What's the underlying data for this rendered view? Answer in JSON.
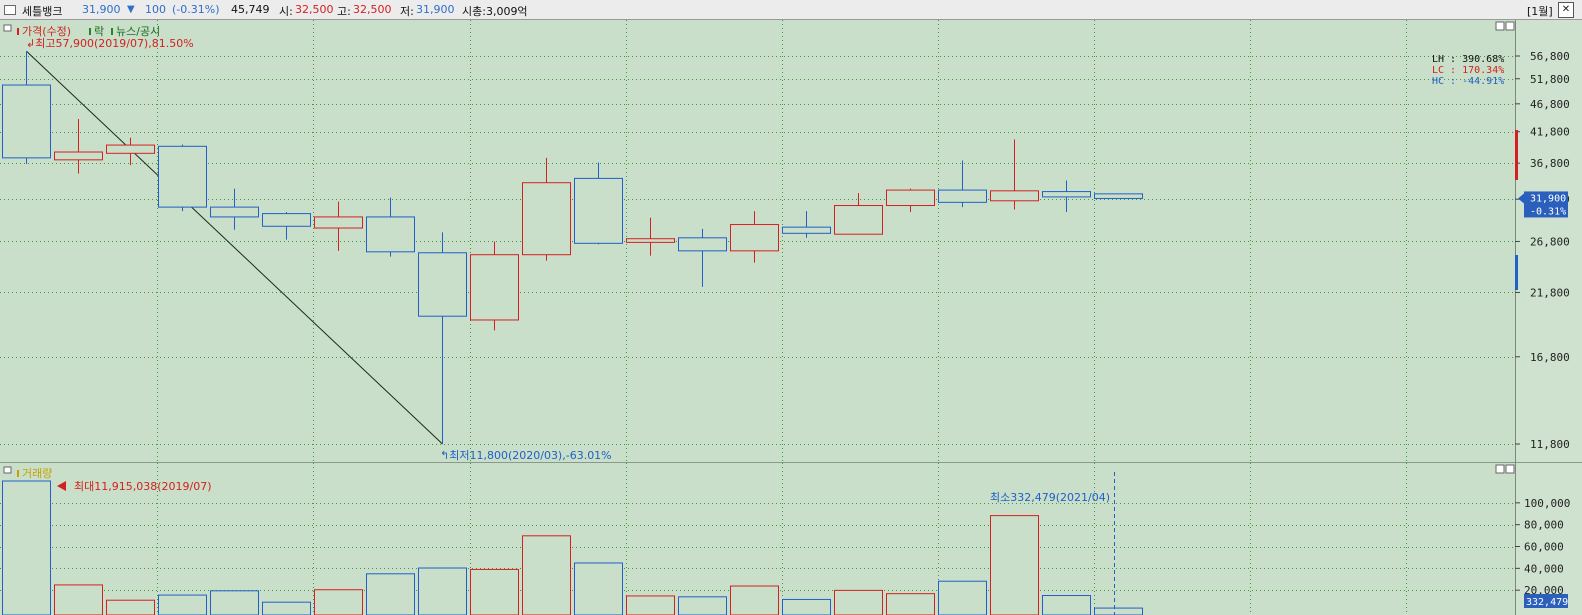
{
  "header": {
    "name": "세틀뱅크",
    "price": "31,900",
    "change_arrow": "▼",
    "change": "100",
    "change_pct": "(-0.31%)",
    "volume": "45,749",
    "open_label": "시:",
    "open": "32,500",
    "high_label": "고:",
    "high": "32,500",
    "low_label": "저:",
    "low": "31,900",
    "mcap": "시총:3,009억",
    "period": "[1월]",
    "close_glyph": "✕"
  },
  "price_panel": {
    "legend_price": "가격(수정)",
    "legend_ex": "락",
    "legend_news": "뉴스/공시",
    "max_annotation": "최고57,900(2019/07),81.50%",
    "min_annotation": "최저11,800(2020/03),-63.01%",
    "lh": "LH : 390.68%",
    "lc": "LC : 170.34%",
    "hc": "HC : -44.91%",
    "current_price_tag": "31,900",
    "current_change_tag": "-0.31%"
  },
  "volume_panel": {
    "legend": "거래량",
    "max_annotation": "최대11,915,038(2019/07)",
    "min_annotation": "최소332,479(2021/04)",
    "current_volume_tag": "332,479"
  },
  "colors": {
    "up": "#d42020",
    "down": "#2060c8",
    "background": "#c9dfc9",
    "grid": "#3a9a3a"
  },
  "chart_data": [
    {
      "type": "candlestick",
      "title": "가격(수정)",
      "interval": "monthly",
      "y_scale": "log",
      "ylim": [
        10800,
        62000
      ],
      "y_ticks": [
        56800,
        51800,
        46800,
        41800,
        36800,
        31800,
        26800,
        21800,
        16800,
        11800
      ],
      "candles": [
        {
          "open": 50500,
          "high": 57900,
          "low": 36700,
          "close": 37600,
          "dir": "down"
        },
        {
          "open": 37300,
          "high": 44000,
          "low": 35300,
          "close": 38500,
          "dir": "up"
        },
        {
          "open": 38300,
          "high": 40800,
          "low": 36500,
          "close": 39600,
          "dir": "up"
        },
        {
          "open": 39400,
          "high": 39700,
          "low": 30300,
          "close": 30800,
          "dir": "down"
        },
        {
          "open": 30800,
          "high": 33200,
          "low": 28100,
          "close": 29600,
          "dir": "down"
        },
        {
          "open": 30000,
          "high": 30200,
          "low": 27000,
          "close": 28500,
          "dir": "down"
        },
        {
          "open": 28300,
          "high": 31500,
          "low": 25800,
          "close": 29600,
          "dir": "up"
        },
        {
          "open": 29600,
          "high": 32000,
          "low": 25200,
          "close": 25700,
          "dir": "down"
        },
        {
          "open": 25600,
          "high": 27800,
          "low": 11800,
          "close": 19800,
          "dir": "down"
        },
        {
          "open": 19500,
          "high": 26800,
          "low": 18700,
          "close": 25400,
          "dir": "up"
        },
        {
          "open": 25400,
          "high": 37600,
          "low": 24800,
          "close": 34000,
          "dir": "up"
        },
        {
          "open": 34600,
          "high": 36900,
          "low": 26500,
          "close": 26600,
          "dir": "down"
        },
        {
          "open": 26700,
          "high": 29500,
          "low": 25300,
          "close": 27100,
          "dir": "up"
        },
        {
          "open": 27200,
          "high": 28200,
          "low": 22300,
          "close": 25800,
          "dir": "down"
        },
        {
          "open": 25800,
          "high": 30300,
          "low": 24600,
          "close": 28700,
          "dir": "up"
        },
        {
          "open": 28400,
          "high": 30300,
          "low": 27200,
          "close": 27700,
          "dir": "down"
        },
        {
          "open": 27600,
          "high": 32600,
          "low": 27600,
          "close": 31000,
          "dir": "up"
        },
        {
          "open": 31000,
          "high": 33200,
          "low": 30200,
          "close": 33000,
          "dir": "up"
        },
        {
          "open": 33000,
          "high": 37200,
          "low": 30800,
          "close": 31400,
          "dir": "down"
        },
        {
          "open": 31600,
          "high": 40500,
          "low": 30500,
          "close": 32900,
          "dir": "up"
        },
        {
          "open": 32800,
          "high": 34300,
          "low": 30200,
          "close": 32100,
          "dir": "down"
        },
        {
          "open": 32500,
          "high": 32500,
          "low": 31900,
          "close": 31900,
          "dir": "down"
        }
      ]
    },
    {
      "type": "bar",
      "title": "거래량",
      "ylim": [
        0,
        120000
      ],
      "y_ticks": [
        100000,
        80000,
        60000,
        40000,
        20000
      ],
      "values": [
        120000,
        24800,
        10800,
        15500,
        19400,
        9000,
        20400,
        35000,
        40300,
        39000,
        69800,
        44900,
        14700,
        13900,
        23800,
        11500,
        19800,
        16800,
        28200,
        88300,
        15100,
        3600
      ],
      "dirs": [
        "down",
        "up",
        "up",
        "down",
        "down",
        "down",
        "up",
        "down",
        "down",
        "up",
        "up",
        "down",
        "up",
        "down",
        "up",
        "down",
        "up",
        "up",
        "down",
        "up",
        "down",
        "down"
      ]
    }
  ]
}
